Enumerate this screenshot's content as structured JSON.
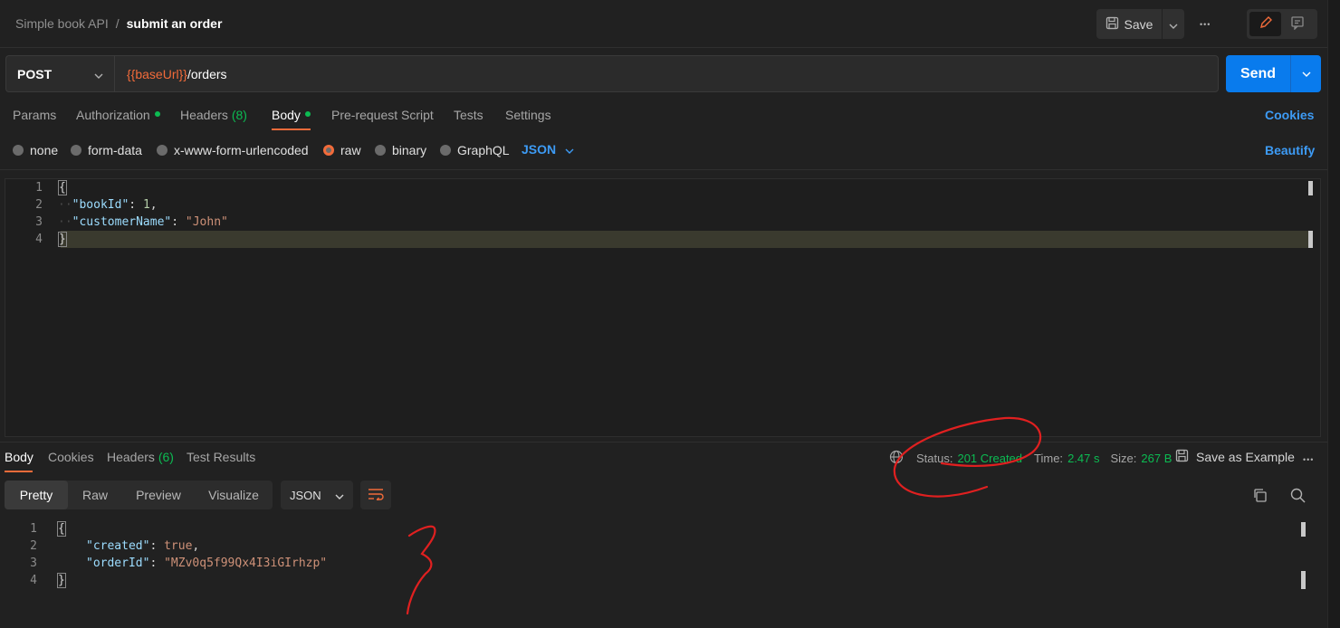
{
  "breadcrumb": {
    "collection": "Simple book API",
    "separator": "/",
    "request": "submit an order"
  },
  "toolbar": {
    "save_label": "Save",
    "more": "•••"
  },
  "request": {
    "method": "POST",
    "url_var": "{{baseUrl}}",
    "url_path": "/orders",
    "send_label": "Send"
  },
  "request_tabs": {
    "params": "Params",
    "authorization": "Authorization",
    "headers": "Headers",
    "headers_count": "(8)",
    "body": "Body",
    "prerequest": "Pre-request Script",
    "tests": "Tests",
    "settings": "Settings",
    "cookies": "Cookies"
  },
  "body_types": {
    "none": "none",
    "form_data": "form-data",
    "urlencoded": "x-www-form-urlencoded",
    "raw": "raw",
    "binary": "binary",
    "graphql": "GraphQL",
    "language": "JSON",
    "beautify": "Beautify"
  },
  "request_body": {
    "lines": [
      "1",
      "2",
      "3",
      "4"
    ],
    "open_brace": "{",
    "close_brace": "}",
    "key1": "\"bookId\"",
    "val1": "1",
    "key2": "\"customerName\"",
    "val2": "\"John\""
  },
  "response_tabs": {
    "body": "Body",
    "cookies": "Cookies",
    "headers": "Headers",
    "headers_count": "(6)",
    "test_results": "Test Results"
  },
  "response_meta": {
    "status_label": "Status:",
    "status_value": "201 Created",
    "time_label": "Time:",
    "time_value": "2.47 s",
    "size_label": "Size:",
    "size_value": "267 B",
    "save_example": "Save as Example"
  },
  "response_view": {
    "pretty": "Pretty",
    "raw": "Raw",
    "preview": "Preview",
    "visualize": "Visualize",
    "format": "JSON"
  },
  "response_body": {
    "lines": [
      "1",
      "2",
      "3",
      "4"
    ],
    "open_brace": "{",
    "close_brace": "}",
    "key1": "\"created\"",
    "val1": "true",
    "key2": "\"orderId\"",
    "val2": "\"MZv0q5f99Qx4I3iGIrhzp\""
  },
  "colors": {
    "accent_orange": "#f26b3a",
    "link_blue": "#3d9bf5",
    "send_blue": "#097bed",
    "success_green": "#0cbb52",
    "annotation_red": "#e02020"
  }
}
